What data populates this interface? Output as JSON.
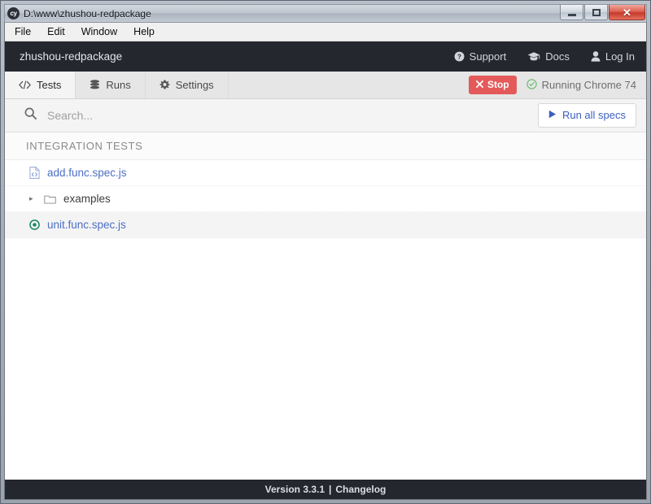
{
  "window": {
    "title": "D:\\www\\zhushou-redpackage",
    "logo_text": "cy",
    "minimize_label": "Minimize",
    "maximize_label": "Maximize",
    "close_label": "✕"
  },
  "menubar": {
    "items": [
      {
        "label": "File"
      },
      {
        "label": "Edit"
      },
      {
        "label": "Window"
      },
      {
        "label": "Help"
      }
    ]
  },
  "header": {
    "project_name": "zhushou-redpackage",
    "links": [
      {
        "label": "Support",
        "icon": "question-circle-icon"
      },
      {
        "label": "Docs",
        "icon": "graduation-cap-icon"
      },
      {
        "label": "Log In",
        "icon": "user-icon"
      }
    ]
  },
  "tabs": [
    {
      "label": "Tests",
      "icon": "code-icon",
      "active": true
    },
    {
      "label": "Runs",
      "icon": "database-icon",
      "active": false
    },
    {
      "label": "Settings",
      "icon": "gear-icon",
      "active": false
    }
  ],
  "run_controls": {
    "stop_label": "Stop",
    "stop_icon": "close-icon",
    "browser_status": "Running Chrome 74",
    "browser_status_icon": "check-circle-icon"
  },
  "toolbar": {
    "search_placeholder": "Search...",
    "search_value": "",
    "search_icon": "search-icon",
    "run_all_label": "Run all specs",
    "run_all_icon": "play-icon"
  },
  "spec_list": {
    "group_header": "INTEGRATION TESTS",
    "rows": [
      {
        "name": "add.func.spec.js",
        "type": "file",
        "icon": "file-code-icon",
        "active": false
      },
      {
        "name": "examples",
        "type": "folder",
        "icon": "folder-icon",
        "disclosure": "▸",
        "active": false
      },
      {
        "name": "unit.func.spec.js",
        "type": "file",
        "icon": "running-dot-icon",
        "active": true
      }
    ]
  },
  "footer": {
    "version_text": "Version 3.3.1",
    "separator": "|",
    "changelog_label": "Changelog"
  },
  "colors": {
    "header_bg": "#25272e",
    "accent_link": "#4d6ec4",
    "stop_red": "#e45a5a",
    "status_green": "#3aa655"
  }
}
